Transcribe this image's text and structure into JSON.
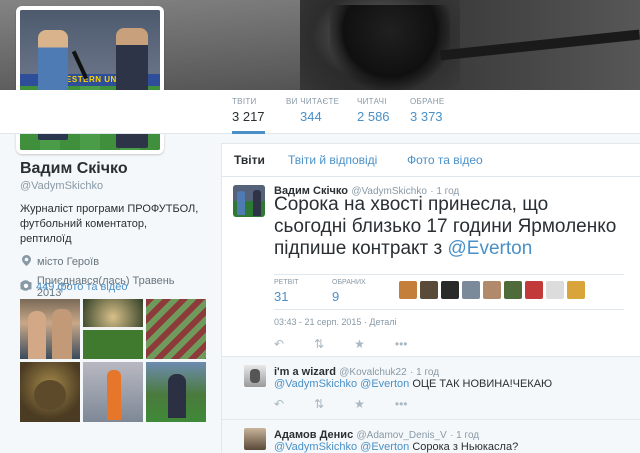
{
  "banner": {
    "description_icon": "banner-image"
  },
  "avatar": {
    "board_text": "WESTERN UNION"
  },
  "nav": {
    "stats": [
      {
        "label": "ТВІТИ",
        "value": "3 217"
      },
      {
        "label": "ВИ ЧИТАЄТЕ",
        "value": "344"
      },
      {
        "label": "ЧИТАЧІ",
        "value": "2 586"
      },
      {
        "label": "ОБРАНЕ",
        "value": "3 373"
      }
    ]
  },
  "profile": {
    "name": "Вадим Скічко",
    "handle": "@VadymSkichko",
    "bio": "Журналіст програми ПРОФУТБОЛ, футбольний коментатор, рептилоїд",
    "location": "місто Героїв",
    "joined": "Приєднався(лась) Травень 2013",
    "photos_link": "449 фото та відео",
    "location_icon": "map-pin-icon",
    "joined_icon": "clock-icon",
    "photos_icon": "camera-icon"
  },
  "timeline": {
    "tabs": [
      "Твіти",
      "Твіти й відповіді",
      "Фото та відео"
    ],
    "tweet": {
      "name": "Вадим Скічко",
      "handle": "@VadymSkichko",
      "time": "· 1 год",
      "text": "Сорока на хвості принесла, що сьогодні близько 17 години Ярмоленко підпише контракт з ",
      "mention": "@Everton",
      "retweets_label": "РЕТВІТ",
      "retweets": "31",
      "favorites_label": "ОБРАНИХ",
      "favorites": "9",
      "date": "03:43 - 21 серп. 2015 · Деталі"
    },
    "replies": [
      {
        "name": "i'm a wizard",
        "handle": "@Kovalchuk22",
        "time": "· 1 год",
        "mention1": "@VadymSkichko",
        "mention2": "@Everton",
        "text": "ОЦЕ ТАК НОВИНА!ЧЕКАЮ"
      },
      {
        "name": "Адамов Денис",
        "handle": "@Adamov_Denis_V",
        "time": "· 1 год",
        "mention1": "@VadymSkichko",
        "mention2": "@Everton",
        "text": "Сорока з Ньюкасла?"
      }
    ],
    "action_icons": [
      "reply-icon",
      "retweet-icon",
      "favorite-icon",
      "more-icon"
    ]
  },
  "colors": {
    "link": "#4a90c7",
    "muted": "#8899a6",
    "text": "#292f33"
  }
}
